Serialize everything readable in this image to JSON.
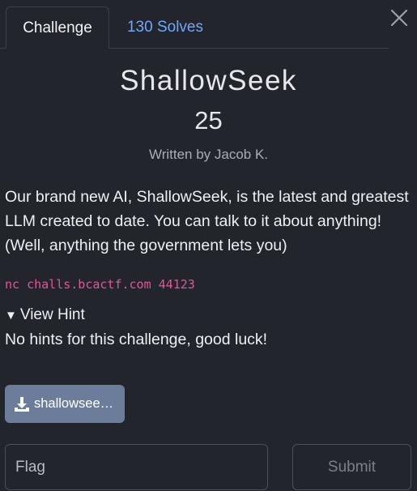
{
  "tabs": {
    "challenge": "Challenge",
    "solves": "130 Solves"
  },
  "challenge": {
    "name": "ShallowSeek",
    "points": "25",
    "author": "Written by Jacob K.",
    "description": "Our brand new AI, ShallowSeek, is the latest and greatest LLM created to date. You can talk to it about anything! (Well, anything the government lets you)",
    "connection": "nc challs.bcactf.com 44123"
  },
  "hint": {
    "toggle_label": "View Hint",
    "text": "No hints for this challenge, good luck!"
  },
  "file": {
    "label": "shallowsee…"
  },
  "form": {
    "flag_placeholder": "Flag",
    "submit_label": "Submit"
  },
  "colors": {
    "background": "#22252b",
    "link_blue": "#6ea8fe",
    "code_pink": "#e0569c",
    "file_button": "#6c7d9c"
  }
}
